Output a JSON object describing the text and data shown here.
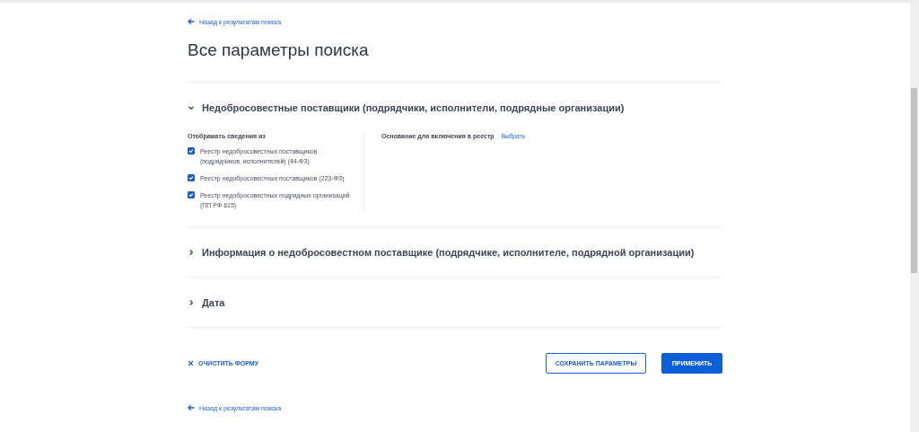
{
  "back_link_top": "Назад к результатам поиска",
  "title": "Все параметры поиска",
  "sections": [
    {
      "title": "Недобросовестные поставщики (подрядчики, исполнители, подрядные организации)",
      "expanded": true,
      "sources": {
        "label": "Отображать сведения из",
        "options": [
          {
            "label": "Реестр недобросовестных поставщиков (подрядчиков, исполнителей) (44-ФЗ)",
            "checked": true
          },
          {
            "label": "Реестр недобросовестных поставщиков (223-ФЗ)",
            "checked": true
          },
          {
            "label": "Реестр недобросовестных подрядных организаций (ПП РФ 615)",
            "checked": true
          }
        ]
      },
      "basis": {
        "label": "Основание для включения в реестр",
        "link": "Выбрать"
      }
    },
    {
      "title": "Информация о недобросовестном поставщике (подрядчике, исполнителе, подрядной организации)",
      "expanded": false
    },
    {
      "title": "Дата",
      "expanded": false
    }
  ],
  "actions": {
    "clear": "ОЧИСТИТЬ ФОРМУ",
    "save": "СОХРАНИТЬ ПАРАМЕТРЫ",
    "apply": "ПРИМЕНИТЬ"
  },
  "back_link_bottom": "Назад к результатам поиска"
}
